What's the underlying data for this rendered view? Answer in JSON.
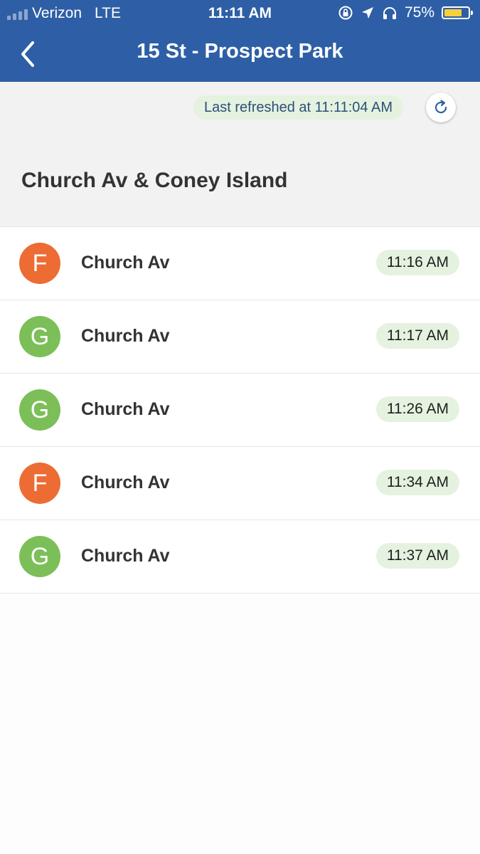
{
  "status_bar": {
    "carrier": "Verizon",
    "network": "LTE",
    "time": "11:11 AM",
    "battery_percent": "75%",
    "battery_level": 0.75,
    "icons": [
      "orientation-lock-icon",
      "location-arrow-icon",
      "headphones-icon",
      "battery-icon"
    ]
  },
  "nav": {
    "title": "15 St - Prospect Park",
    "back_icon": "chevron-left-icon"
  },
  "refresh": {
    "label": "Last refreshed at 11:11:04 AM",
    "icon": "refresh-icon"
  },
  "section": {
    "title": "Church Av & Coney Island"
  },
  "arrivals": [
    {
      "route": "F",
      "destination": "Church Av",
      "time": "11:16 AM"
    },
    {
      "route": "G",
      "destination": "Church Av",
      "time": "11:17 AM"
    },
    {
      "route": "G",
      "destination": "Church Av",
      "time": "11:26 AM"
    },
    {
      "route": "F",
      "destination": "Church Av",
      "time": "11:34 AM"
    },
    {
      "route": "G",
      "destination": "Church Av",
      "time": "11:37 AM"
    }
  ],
  "colors": {
    "nav_blue": "#2e5fa6",
    "route_F": "#ec6c34",
    "route_G": "#7cbf58",
    "pill_green": "#e4f2df"
  }
}
